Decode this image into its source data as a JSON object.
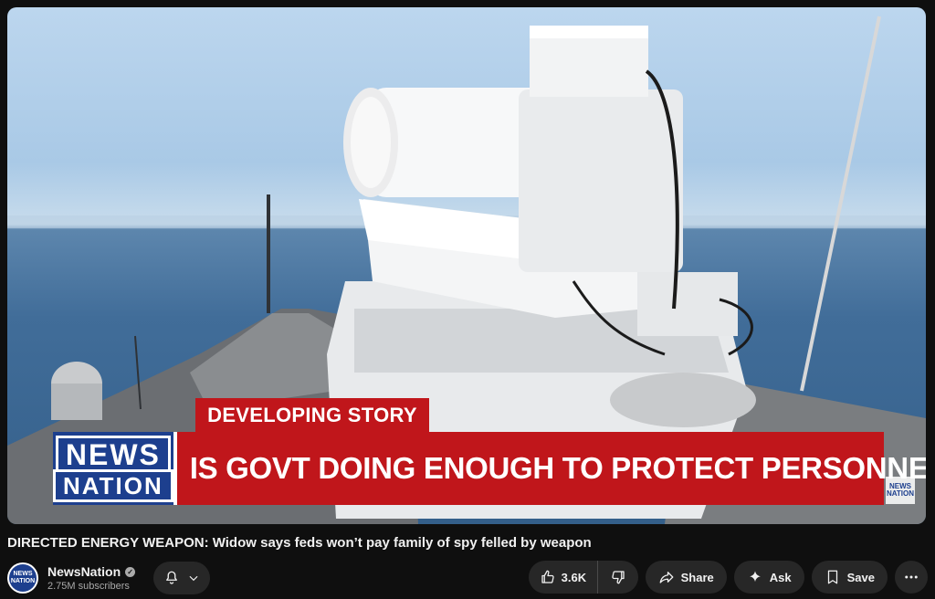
{
  "video": {
    "badge_text": "DEVELOPING STORY",
    "headline": "IS GOVT DOING ENOUGH TO PROTECT PERSONNEL?",
    "logo_line1": "NEWS",
    "logo_line2": "NATION",
    "watermark_line1": "NEWS",
    "watermark_line2": "NATION"
  },
  "title": "DIRECTED ENERGY WEAPON: Widow says feds won’t pay family of spy felled by weapon",
  "channel": {
    "name": "NewsNation",
    "subscribers": "2.75M subscribers",
    "avatar_line1": "NEWS",
    "avatar_line2": "NATION"
  },
  "actions": {
    "like_count": "3.6K",
    "share_label": "Share",
    "ask_label": "Ask",
    "save_label": "Save"
  },
  "colors": {
    "lower_third_red": "#c0161b",
    "brand_blue": "#1d3f8e",
    "background": "#0f0f0f",
    "button_bg": "#272727"
  },
  "icons": [
    "bell-icon",
    "chevron-down-icon",
    "thumbs-up-icon",
    "thumbs-down-icon",
    "share-icon",
    "sparkle-icon",
    "bookmark-icon",
    "more-icon",
    "verified-icon"
  ]
}
